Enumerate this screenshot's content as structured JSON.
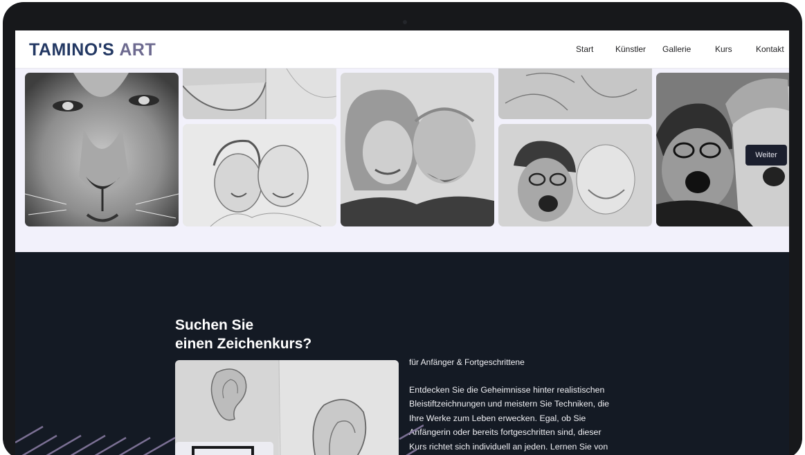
{
  "header": {
    "logo_part1": "TAMINO'S",
    "logo_part2": "ART",
    "nav": [
      {
        "label": "Start"
      },
      {
        "label": "Künstler"
      },
      {
        "label": "Gallerie"
      },
      {
        "label": "Kurs"
      },
      {
        "label": "Kontakt"
      }
    ]
  },
  "gallery": {
    "next_button": "Weiter",
    "tiles": [
      {
        "subject": "lion-drawing"
      },
      {
        "subject": "portrait-sketch-partial"
      },
      {
        "subject": "couple-pencil-sketch"
      },
      {
        "subject": "couple-pencil-drawing-finished"
      },
      {
        "subject": "line-sketch-partial"
      },
      {
        "subject": "laughing-man-sketch"
      },
      {
        "subject": "laughing-people-drawing"
      }
    ]
  },
  "course": {
    "title_line1": "Suchen Sie",
    "title_line2": "einen Zeichenkurs?",
    "subtitle": "für Anfänger & Fortgeschrittene",
    "body_lines": [
      "Entdecken Sie die Geheimnisse hinter realistischen",
      "Bleistiftzeichnungen und meistern Sie Techniken, die",
      "Ihre Werke zum Leben erwecken. Egal, ob Sie",
      "Anfängerin oder bereits fortgeschritten sind, dieser",
      "Kurs richtet sich individuell an jeden. Lernen Sie von"
    ]
  },
  "colors": {
    "logo_primary": "#233863",
    "logo_accent": "#6d6a8f",
    "dark_section": "#141a24",
    "page_bg": "#f2f1fb",
    "stripe_accent": "#8e7fa8"
  }
}
